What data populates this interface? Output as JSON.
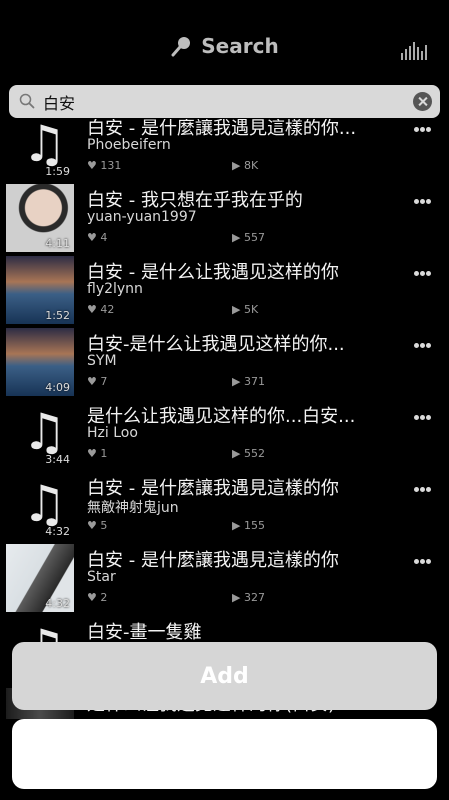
{
  "header": {
    "title": "Search",
    "title_icon": "microphone-icon",
    "right_icon": "equalizer-icon"
  },
  "search": {
    "value": "白安",
    "placeholder": "",
    "icon": "magnifier-icon",
    "clear_icon": "clear-icon"
  },
  "tracks": [
    {
      "title": "白安 - 是什麼讓我遇見這樣的你...",
      "artist": "Phoebeifern",
      "duration": "1:59",
      "likes": "131",
      "plays": "8K",
      "thumb": "music-note-icon"
    },
    {
      "title": "白安 - 我只想在乎我在乎的",
      "artist": "yuan-yuan1997",
      "duration": "4:11",
      "likes": "4",
      "plays": "557",
      "thumb": "photo"
    },
    {
      "title": "白安 -  是什么让我遇见这样的你",
      "artist": "fly2lynn",
      "duration": "1:52",
      "likes": "42",
      "plays": "5K",
      "thumb": "photo"
    },
    {
      "title": "白安-是什么让我遇见这样的你...",
      "artist": "SYM",
      "duration": "4:09",
      "likes": "7",
      "plays": "371",
      "thumb": "photo"
    },
    {
      "title": "是什么让我遇见这样的你...白安...",
      "artist": "Hzi Loo",
      "duration": "3:44",
      "likes": "1",
      "plays": "552",
      "thumb": "music-note-icon"
    },
    {
      "title": "白安 - 是什麼讓我遇見這樣的你",
      "artist": "無敵神射鬼jun",
      "duration": "4:32",
      "likes": "5",
      "plays": "155",
      "thumb": "music-note-icon"
    },
    {
      "title": "白安 - 是什麼讓我遇見這樣的你",
      "artist": "Star",
      "duration": "4:32",
      "likes": "2",
      "plays": "327",
      "thumb": "photo"
    },
    {
      "title": "白安-畫一隻雞",
      "artist": "",
      "duration": "",
      "likes": "",
      "plays": "",
      "thumb": "music-note-icon"
    },
    {
      "title": "是什么让我遇见这样的你(白安)...",
      "artist": "",
      "duration": "",
      "likes": "",
      "plays": "",
      "thumb": "photo"
    }
  ],
  "actions": {
    "add_label": "Add"
  },
  "colors": {
    "background": "#000000",
    "search_bg": "#d9d9d9",
    "add_button_bg": "#d6d6d6"
  }
}
